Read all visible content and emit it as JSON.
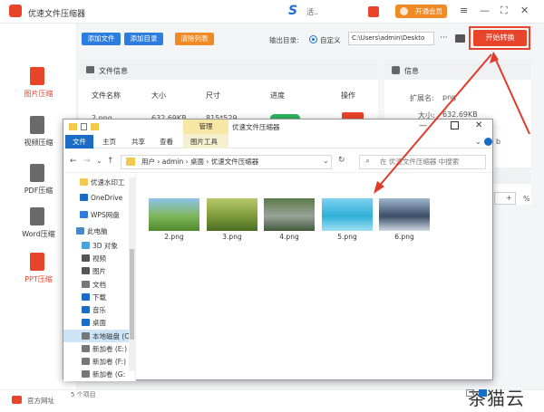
{
  "app": {
    "title": "优速文件压缩器",
    "brand_mark": "S",
    "brand_text": "活..",
    "vip_label": "开通会员"
  },
  "window_controls": {
    "menu": "≡",
    "minimize": "—",
    "maximize": "⛶",
    "close": "✕"
  },
  "sidebar": {
    "items": [
      {
        "label": "图片压缩",
        "color": "#e8442a",
        "active": true
      },
      {
        "label": "视频压缩",
        "color": "#6a6a6a",
        "active": false
      },
      {
        "label": "PDF压缩",
        "color": "#6a6a6a",
        "active": false
      },
      {
        "label": "Word压缩",
        "color": "#6a6a6a",
        "active": false
      },
      {
        "label": "PPT压缩",
        "color": "#e8442a",
        "active": true
      }
    ]
  },
  "toolbar": {
    "add_file": "添加文件",
    "add_folder": "添加目录",
    "clear_list": "清除列表",
    "output_label": "输出目录:",
    "custom_label": "自定义",
    "output_path": "C:\\Users\\admin\\Deskto",
    "more": "···",
    "start": "开始转换"
  },
  "file_panel": {
    "title": "文件信息",
    "columns": [
      "文件名称",
      "大小",
      "尺寸",
      "进度",
      "操作"
    ],
    "rows": [
      {
        "name": "2.png",
        "size": "632.69KB",
        "dims": "815*529"
      }
    ]
  },
  "info_panel": {
    "title": "信息",
    "ext_label": "扩展名:",
    "ext_value": "png",
    "size_label": "大小:",
    "size_value": "632.69KB",
    "side_text": "b",
    "percent": "%",
    "plus": "+"
  },
  "footer": {
    "official_site": "官方网址",
    "watermark": "茶猫云"
  },
  "explorer": {
    "manage_tab": "管理",
    "title": "优速文件压缩器",
    "tabs": [
      "文件",
      "主页",
      "共享",
      "查看",
      "图片工具"
    ],
    "breadcrumb": "用户 › admin › 桌面 › 优速文件压缩器",
    "search_placeholder": "在 优速文件压缩器 中搜索",
    "nav_items": [
      {
        "label": "优速水印工",
        "icon": "folder-icon",
        "color": "#f2c94c"
      },
      {
        "label": "OneDrive",
        "icon": "cloud-icon",
        "color": "#1a6cc7"
      },
      {
        "label": "WPS网盘",
        "icon": "cloud-icon",
        "color": "#2d7de0"
      },
      {
        "label": "此电脑",
        "icon": "computer-icon",
        "color": "#4a89c7"
      },
      {
        "label": "3D 对象",
        "icon": "cube-icon",
        "color": "#4aa3df"
      },
      {
        "label": "视频",
        "icon": "video-icon",
        "color": "#555"
      },
      {
        "label": "图片",
        "icon": "picture-icon",
        "color": "#555"
      },
      {
        "label": "文档",
        "icon": "document-icon",
        "color": "#777"
      },
      {
        "label": "下载",
        "icon": "download-icon",
        "color": "#1a6cc7"
      },
      {
        "label": "音乐",
        "icon": "music-icon",
        "color": "#1a6cc7"
      },
      {
        "label": "桌面",
        "icon": "desktop-icon",
        "color": "#1a6cc7"
      },
      {
        "label": "本地磁盘 (C",
        "icon": "drive-icon",
        "color": "#777"
      },
      {
        "label": "新加卷 (E:)",
        "icon": "drive-icon",
        "color": "#777"
      },
      {
        "label": "新加卷 (F:)",
        "icon": "drive-icon",
        "color": "#777"
      },
      {
        "label": "新加卷 (G:",
        "icon": "drive-icon",
        "color": "#777"
      }
    ],
    "files": [
      {
        "name": "2.png",
        "colors": [
          "#8cc3e8",
          "#7fb65a",
          "#4f8a2f"
        ]
      },
      {
        "name": "3.png",
        "colors": [
          "#b6c96a",
          "#7e9b3b",
          "#4a6e23"
        ]
      },
      {
        "name": "4.png",
        "colors": [
          "#5b7a4a",
          "#9aa39a",
          "#3f5a3a"
        ]
      },
      {
        "name": "5.png",
        "colors": [
          "#7fd0f0",
          "#2fb0d8",
          "#a0e0f2"
        ]
      },
      {
        "name": "6.png",
        "colors": [
          "#9fb6cf",
          "#3b4e66",
          "#cfd8e2"
        ]
      }
    ],
    "status": "5 个项目"
  }
}
